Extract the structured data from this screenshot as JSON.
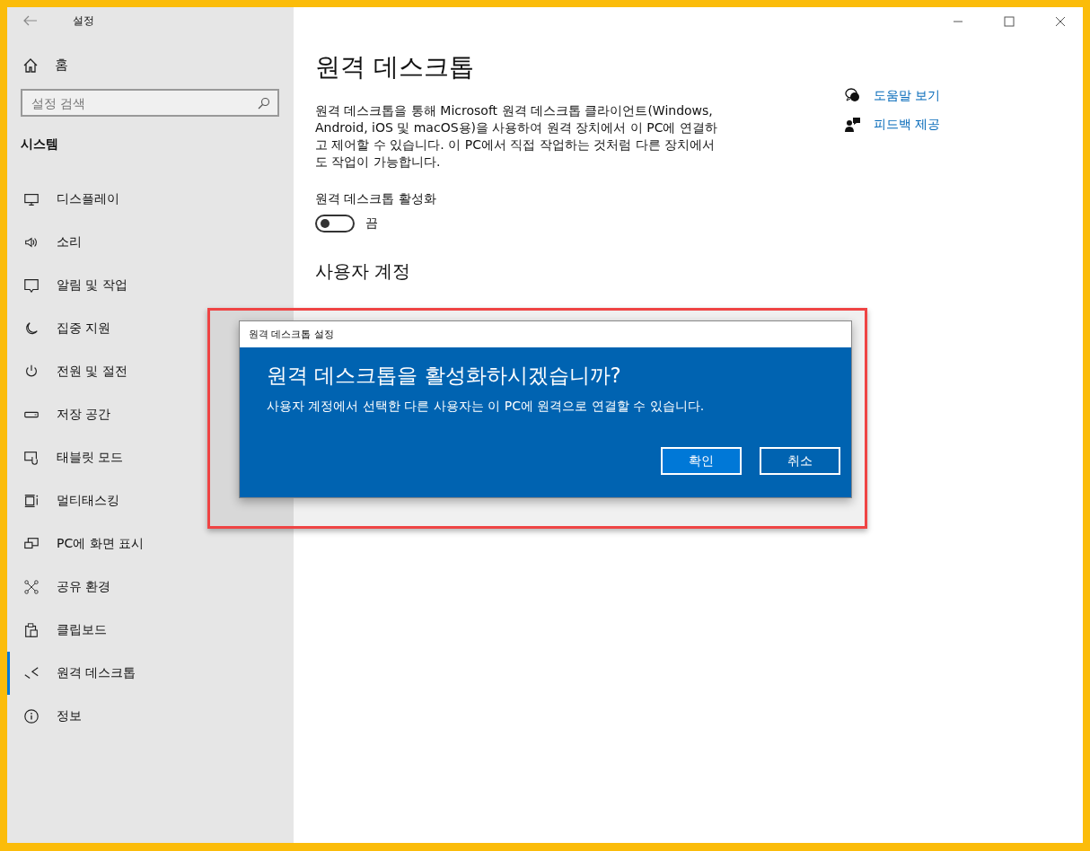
{
  "window": {
    "title": "설정"
  },
  "sidebar": {
    "home": "홈",
    "search": {
      "placeholder": "설정 검색"
    },
    "section": "시스템",
    "items": [
      {
        "kind": "display",
        "label": "디스플레이",
        "selected": false
      },
      {
        "kind": "sound",
        "label": "소리",
        "selected": false
      },
      {
        "kind": "notifications",
        "label": "알림 및 작업",
        "selected": false
      },
      {
        "kind": "focus",
        "label": "집중 지원",
        "selected": false
      },
      {
        "kind": "power",
        "label": "전원 및 절전",
        "selected": false
      },
      {
        "kind": "storage",
        "label": "저장 공간",
        "selected": false
      },
      {
        "kind": "tablet",
        "label": "태블릿 모드",
        "selected": false
      },
      {
        "kind": "multitasking",
        "label": "멀티태스킹",
        "selected": false
      },
      {
        "kind": "projecting",
        "label": "PC에 화면 표시",
        "selected": false
      },
      {
        "kind": "shared",
        "label": "공유 환경",
        "selected": false
      },
      {
        "kind": "clipboard",
        "label": "클립보드",
        "selected": false
      },
      {
        "kind": "remote",
        "label": "원격 데스크톱",
        "selected": true
      },
      {
        "kind": "about",
        "label": "정보",
        "selected": false
      }
    ]
  },
  "main": {
    "title": "원격 데스크톱",
    "description": "원격 데스크톱을 통해 Microsoft 원격 데스크톱 클라이언트(Windows, Android, iOS 및 macOS용)을 사용하여 원격 장치에서 이 PC에 연결하고 제어할 수 있습니다. 이 PC에서 직접 작업하는 것처럼 다른 장치에서도 작업이 가능합니다.",
    "toggle": {
      "label": "원격 데스크톱 활성화",
      "on": false,
      "state_text": "끔"
    },
    "section": "사용자 계정"
  },
  "help_links": [
    {
      "kind": "help",
      "label": "도움말 보기"
    },
    {
      "kind": "feedback",
      "label": "피드백 제공"
    }
  ],
  "dialog": {
    "title": "원격 데스크톱 설정",
    "heading": "원격 데스크톱을 활성화하시겠습니까?",
    "message": "사용자 계정에서 선택한 다른 사용자는 이 PC에 원격으로 연결할 수 있습니다.",
    "buttons": [
      {
        "label": "확인",
        "kind": "primary"
      },
      {
        "label": "취소",
        "kind": "secondary"
      }
    ]
  }
}
